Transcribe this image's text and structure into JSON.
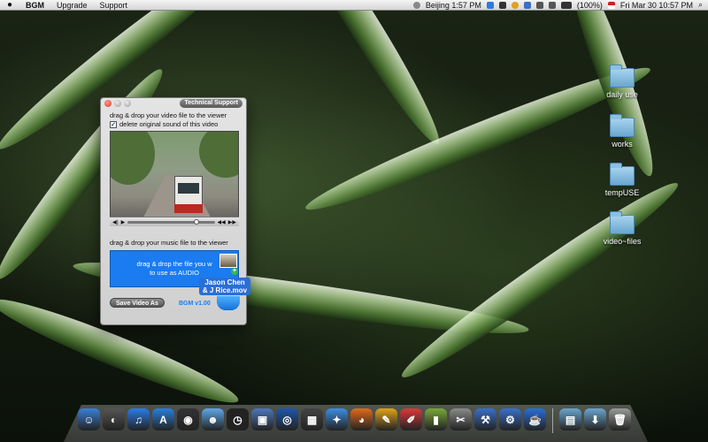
{
  "menubar": {
    "app_name": "BGM",
    "items": [
      "Upgrade",
      "Support"
    ],
    "clock_city": "Beijing 1:57 PM",
    "battery": "(100%)",
    "datetime": "Fri Mar 30  10:57 PM"
  },
  "desktop": {
    "folders": [
      "daily use",
      "works",
      "tempUSE",
      "video~files"
    ]
  },
  "window": {
    "tech_support_label": "Technical Support",
    "video_hint": "drag & drop your video file to the viewer",
    "checkbox_label": "delete original sound of this video",
    "checkbox_checked": true,
    "music_hint": "drag & drop your music file to the viewer",
    "dropzone_line1": "drag & drop the file you w",
    "dropzone_line2": "to use as AUDIO",
    "drag_file_line1": "Jason Chen",
    "drag_file_line2": "& J Rice.mov",
    "save_button": "Save Video As",
    "version": "BGM v1.00"
  },
  "dock": {
    "icons": [
      {
        "name": "finder-icon",
        "color": "#3b7fd9",
        "glyph": "☺"
      },
      {
        "name": "dashboard-icon",
        "color": "#555555",
        "glyph": "◐"
      },
      {
        "name": "itunes-icon",
        "color": "#2c7be5",
        "glyph": "♫"
      },
      {
        "name": "app-store-icon",
        "color": "#2a7fd9",
        "glyph": "A"
      },
      {
        "name": "front-row-icon",
        "color": "#333333",
        "glyph": "◉"
      },
      {
        "name": "ichat-icon",
        "color": "#5fa8e8",
        "glyph": "☻"
      },
      {
        "name": "clock-icon",
        "color": "#222222",
        "glyph": "◷"
      },
      {
        "name": "preview-icon",
        "color": "#4d77b8",
        "glyph": "▣"
      },
      {
        "name": "google-earth-icon",
        "color": "#1f56a8",
        "glyph": "◎"
      },
      {
        "name": "photo-booth-icon",
        "color": "#444444",
        "glyph": "▦"
      },
      {
        "name": "safari-icon",
        "color": "#3e8ee0",
        "glyph": "✦"
      },
      {
        "name": "firefox-icon",
        "color": "#e06a1c",
        "glyph": "◕"
      },
      {
        "name": "pencil-tool-icon",
        "color": "#e0a21c",
        "glyph": "✎"
      },
      {
        "name": "text-edit-icon",
        "color": "#d93a3a",
        "glyph": "✐"
      },
      {
        "name": "chart-app-icon",
        "color": "#7aa83a",
        "glyph": "▮"
      },
      {
        "name": "utility-icon",
        "color": "#8a8a8a",
        "glyph": "✂"
      },
      {
        "name": "xcode-icon",
        "color": "#3a70c8",
        "glyph": "⚒"
      },
      {
        "name": "tools-icon",
        "color": "#3a70c8",
        "glyph": "⚙"
      },
      {
        "name": "java-icon",
        "color": "#2a6fd6",
        "glyph": "☕"
      }
    ],
    "right_icons": [
      {
        "name": "applications-folder-icon",
        "color": "#6aa6cf",
        "glyph": "▤"
      },
      {
        "name": "downloads-folder-icon",
        "color": "#6aa6cf",
        "glyph": "⬇"
      },
      {
        "name": "trash-icon",
        "color": "#9a9a9a",
        "glyph": "🗑"
      }
    ]
  }
}
